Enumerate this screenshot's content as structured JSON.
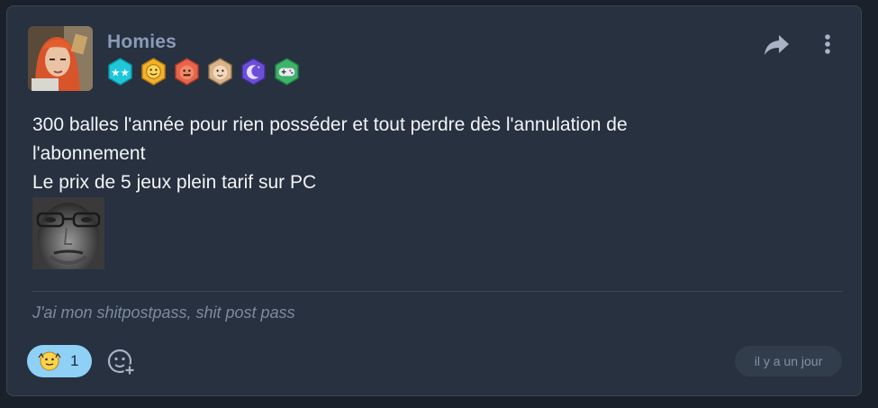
{
  "post": {
    "author": "Homies",
    "badges": [
      {
        "icon": "stars-badge-icon",
        "color": "#1ec8d8"
      },
      {
        "icon": "smile-badge-icon",
        "color": "#f4b22a"
      },
      {
        "icon": "fire-face-badge-icon",
        "color": "#e8644a"
      },
      {
        "icon": "baby-face-badge-icon",
        "color": "#d9b48a"
      },
      {
        "icon": "moon-badge-icon",
        "color": "#6b4fd6"
      },
      {
        "icon": "gamepad-badge-icon",
        "color": "#3fb36a"
      }
    ],
    "text_lines": [
      "300 balles l'année pour rien posséder et tout perdre dès l'annulation de",
      "l'abonnement",
      "Le prix de 5 jeux plein tarif sur PC"
    ],
    "signature": "J'ai mon shitpostpass, shit post pass",
    "reaction": {
      "emoji": "shrug-face-icon",
      "count": "1"
    },
    "time": "il y a un jour"
  },
  "colors": {
    "background": "#1a212b",
    "card": "#27313f",
    "username": "#8b9bb8",
    "reaction_pill": "#8fd0f7"
  }
}
